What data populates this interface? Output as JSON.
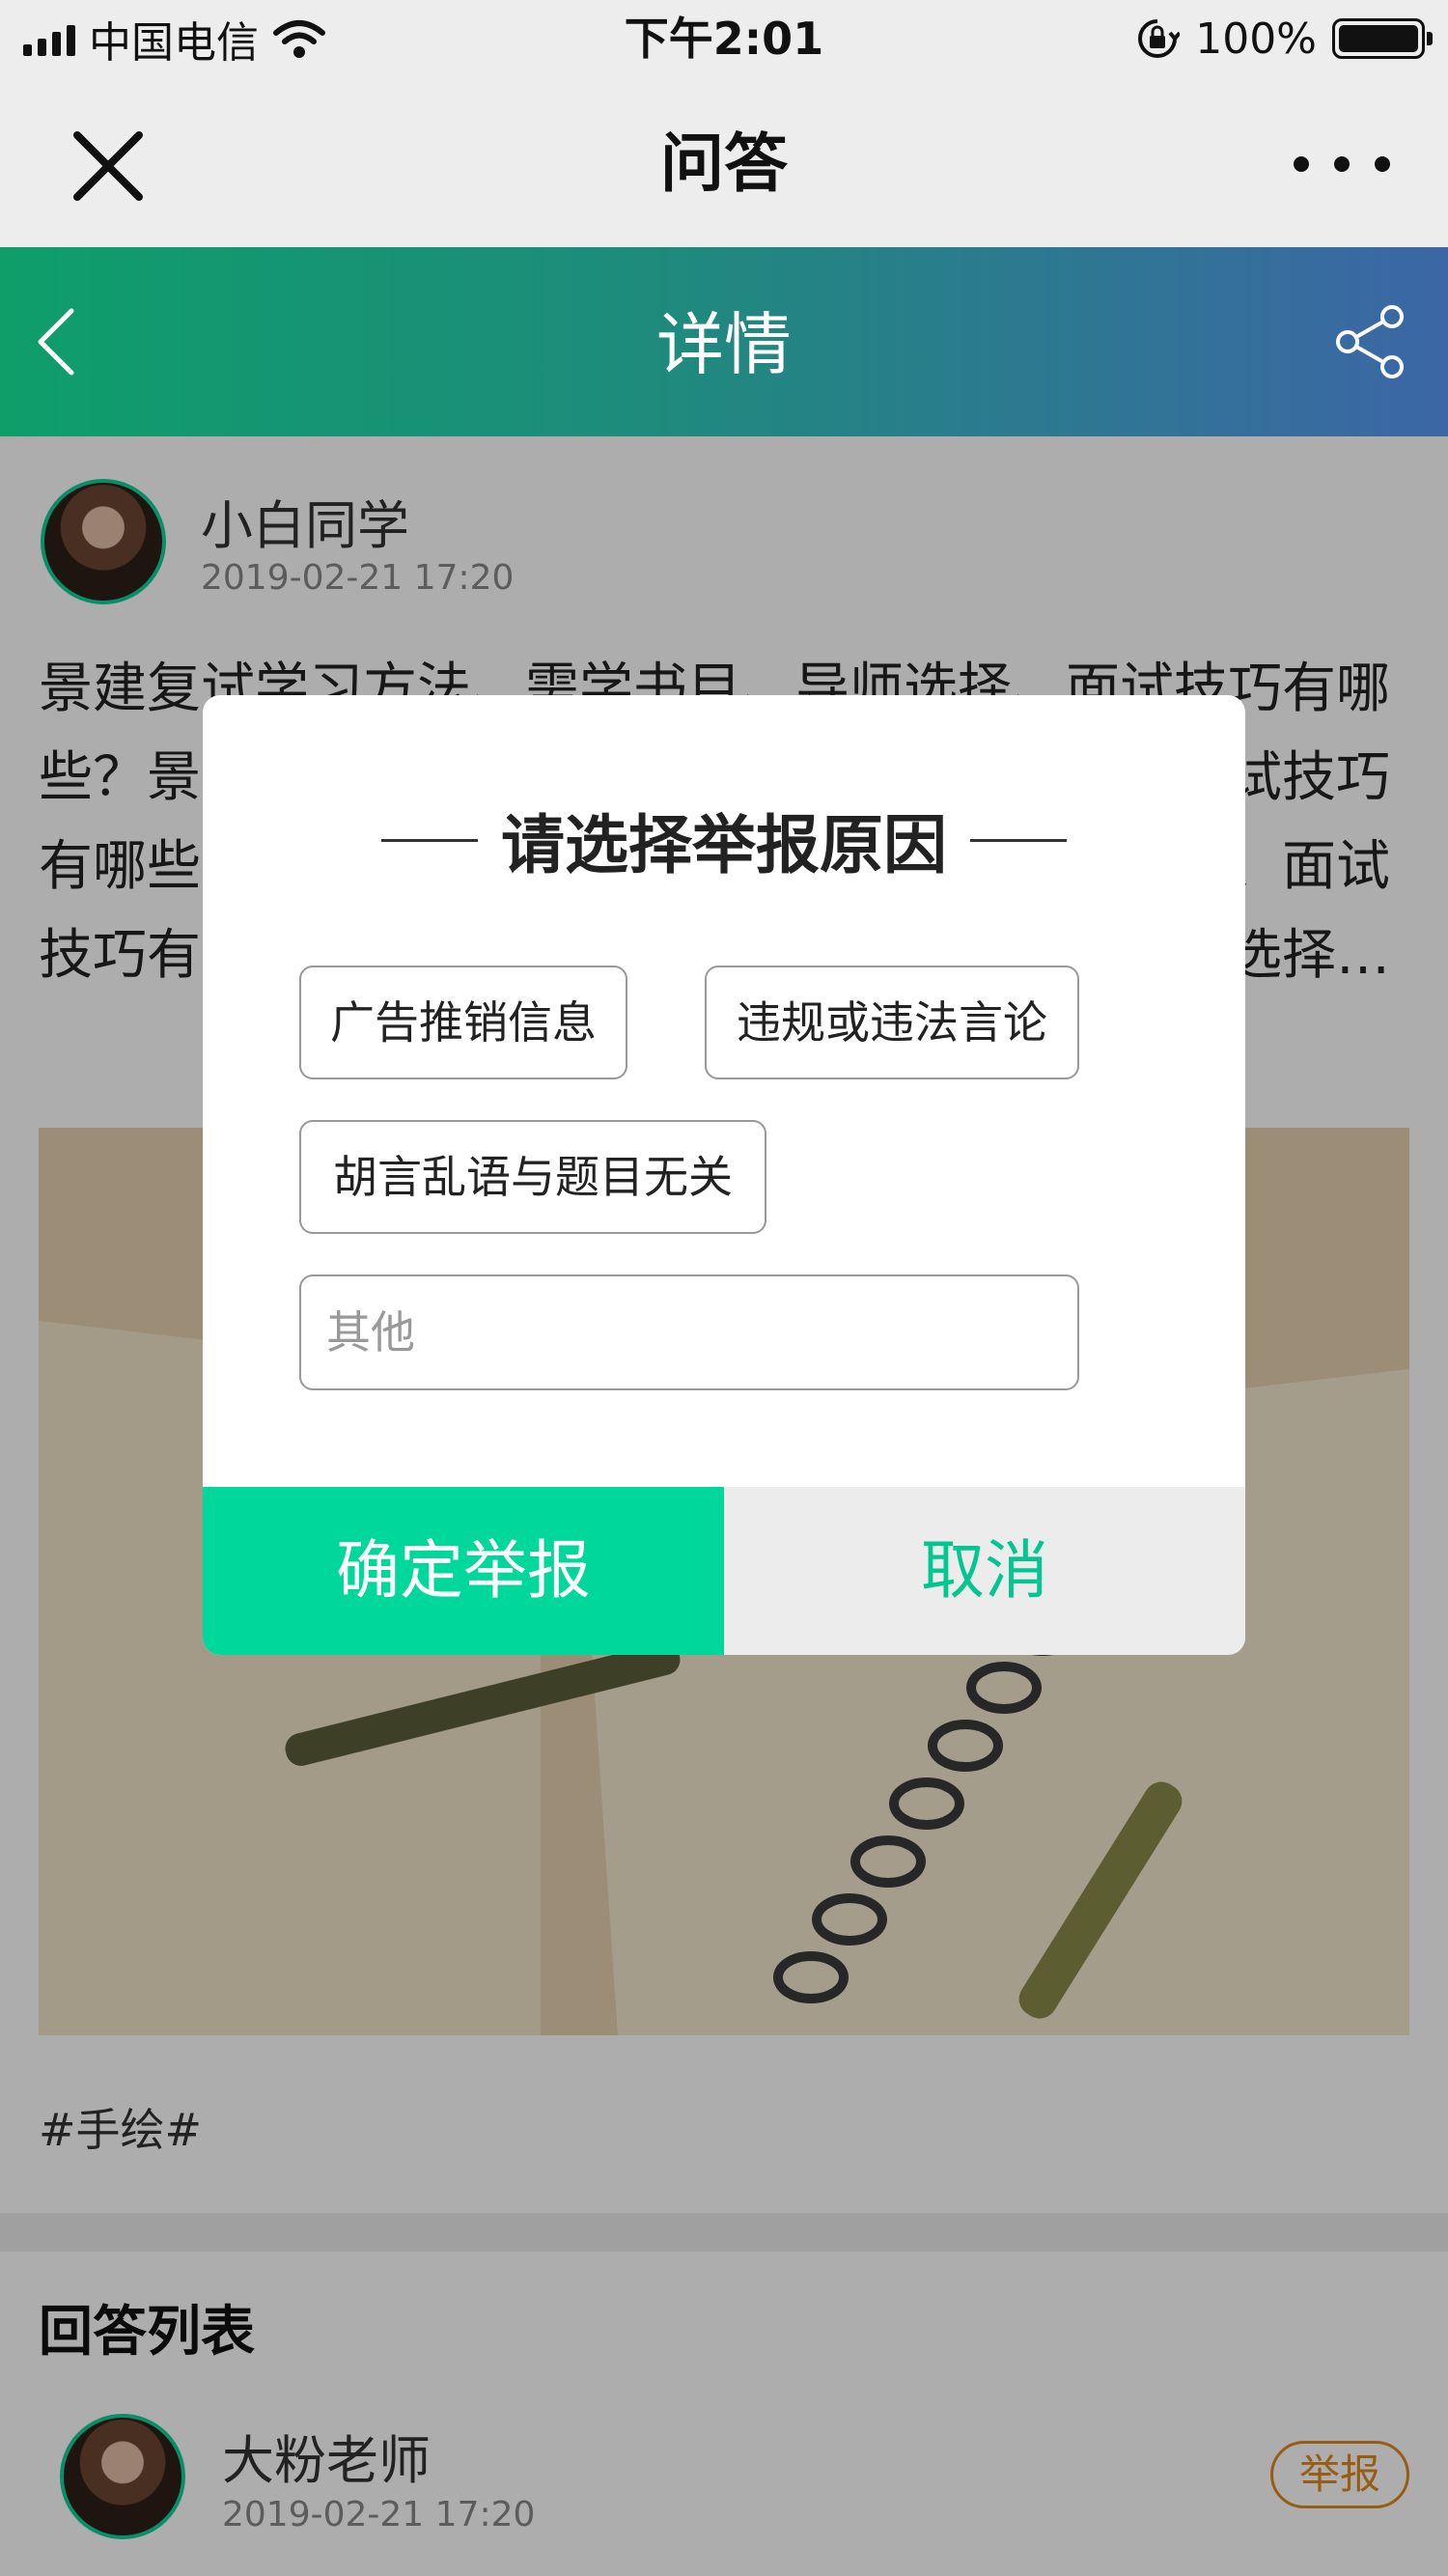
{
  "status_bar": {
    "carrier": "中国电信",
    "time": "下午2:01",
    "battery": "100%"
  },
  "wechat_bar": {
    "title": "问答"
  },
  "header": {
    "title": "详情"
  },
  "post": {
    "author": "小白同学",
    "time": "2019-02-21 17:20",
    "text": "景建复试学习方法、需学书目、导师选择、面试技巧有哪些？景建复试学习方法、需学书目、导师选择、面试技巧有哪些？景建复试学习方法、需学书目、导师选择、面试技巧有哪些？景建复试学习方法、需学书目、导师选择…",
    "tag": "#手绘#"
  },
  "answers": {
    "title": "回答列表",
    "items": [
      {
        "author": "大粉老师",
        "time": "2019-02-21 17:20",
        "report_label": "举报"
      }
    ]
  },
  "report_modal": {
    "title": "请选择举报原因",
    "reasons": [
      "广告推销信息",
      "违规或违法言论",
      "胡言乱语与题目无关"
    ],
    "other_placeholder": "其他",
    "confirm_label": "确定举报",
    "cancel_label": "取消"
  },
  "colors": {
    "accent": "#00d79b",
    "report": "#e08a1e"
  }
}
